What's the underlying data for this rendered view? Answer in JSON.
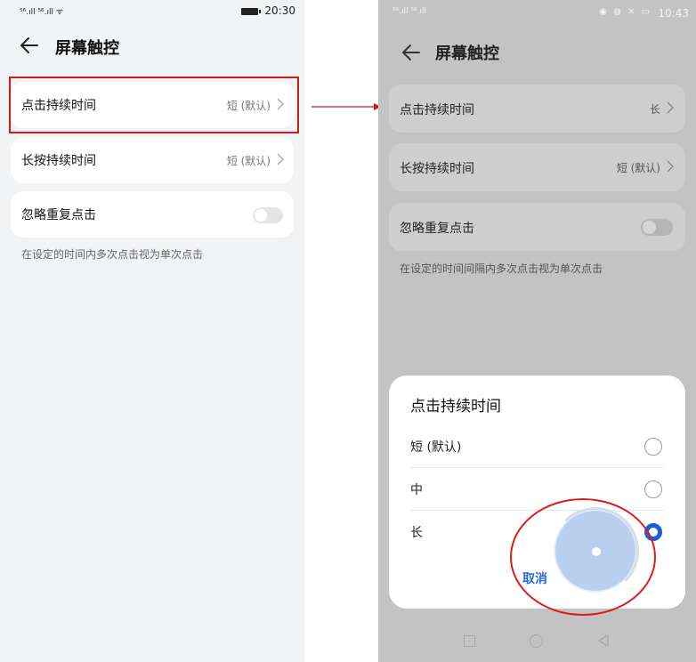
{
  "left": {
    "status": {
      "signal": "⁵⁶.ıll ⁵⁶.ıll ᯤ",
      "time": "20:30"
    },
    "header": {
      "title": "屏幕触控"
    },
    "rows": [
      {
        "label": "点击持续时间",
        "value": "短 (默认)"
      },
      {
        "label": "长按持续时间",
        "value": "短 (默认)"
      },
      {
        "label": "忽略重复点击"
      }
    ],
    "hint": "在设定的时间内多次点击视为单次点击"
  },
  "right": {
    "status": {
      "signal": "⁵⁶.ıll ⁵⁶.ıll",
      "icons": "◉ ◍ ✕ ▭",
      "time": "10:43"
    },
    "header": {
      "title": "屏幕触控"
    },
    "rows": [
      {
        "label": "点击持续时间",
        "value": "长"
      },
      {
        "label": "长按持续时间",
        "value": "短 (默认)"
      },
      {
        "label": "忽略重复点击"
      }
    ],
    "hint": "在设定的时间间隔内多次点击视为单次点击",
    "sheet": {
      "title": "点击持续时间",
      "options": [
        {
          "label": "短 (默认)",
          "selected": false
        },
        {
          "label": "中",
          "selected": false
        },
        {
          "label": "长",
          "selected": true
        }
      ],
      "cancel": "取消"
    }
  },
  "colors": {
    "accent": "#1a5fd6",
    "annotation": "#d91c1c"
  }
}
